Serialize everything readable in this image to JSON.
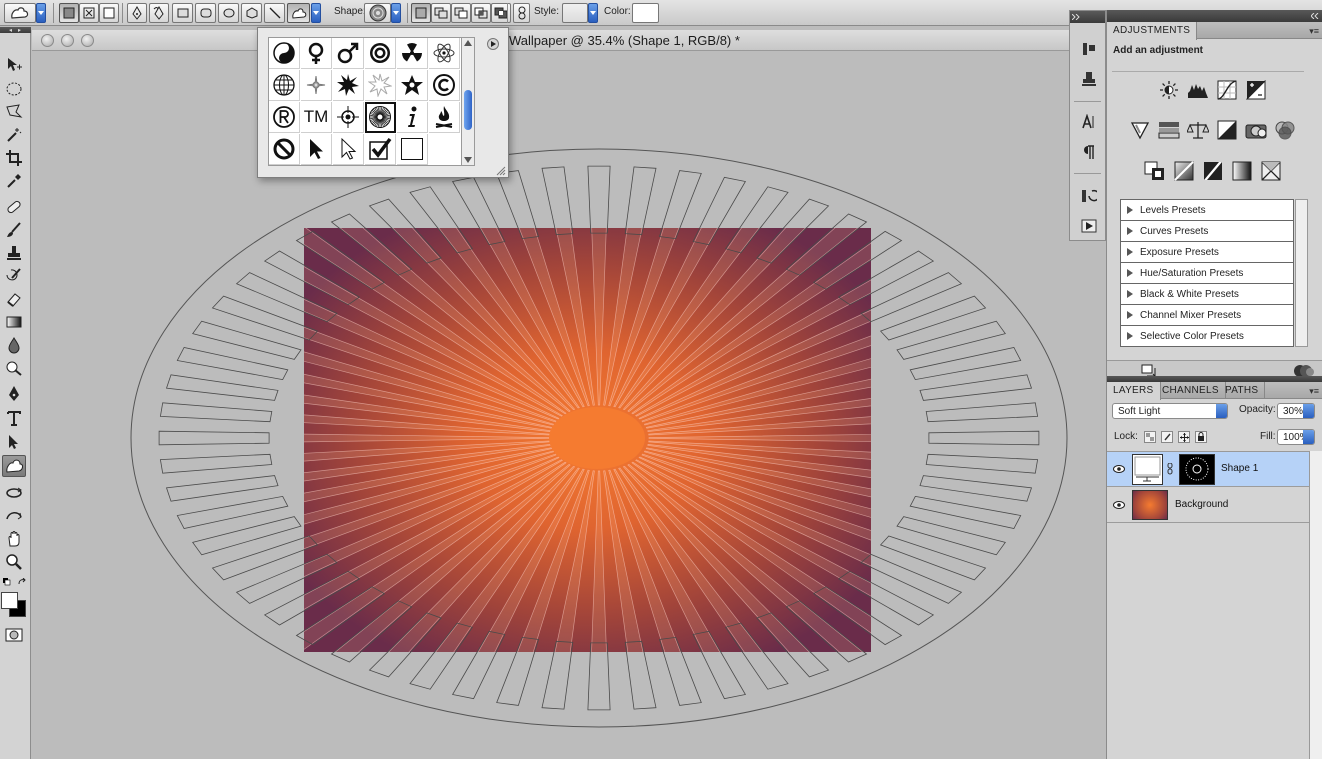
{
  "options_bar": {
    "shape_label": "Shape:",
    "style_label": "Style:",
    "color_label": "Color:",
    "color_value": "#ffffff"
  },
  "document": {
    "title": "Wallpaper @ 35.4% (Shape 1, RGB/8) *"
  },
  "shape_picker": {
    "shapes": [
      "yin-yang-icon",
      "female-symbol-icon",
      "male-symbol-icon",
      "target-icon",
      "radiation-icon",
      "atom-icon",
      "globe-icon",
      "compass-icon",
      "burst-icon",
      "burst-outline-icon",
      "star-icon",
      "copyright-icon",
      "registered-icon",
      "trademark-icon",
      "crosshair-icon",
      "circle-sunburst-icon",
      "info-icon",
      "fire-icon",
      "no-sign-icon",
      "cursor-arrow-icon",
      "cursor-arrow-outline-icon",
      "checkmark-icon",
      "blank-square-icon"
    ],
    "trademark_text": "TM",
    "selected": "circle-sunburst-icon"
  },
  "adjustments_panel": {
    "tab": "ADJUSTMENTS",
    "subtitle": "Add an adjustment",
    "presets": [
      "Levels Presets",
      "Curves Presets",
      "Exposure Presets",
      "Hue/Saturation Presets",
      "Black & White Presets",
      "Channel Mixer Presets",
      "Selective Color Presets"
    ]
  },
  "layers_panel": {
    "tabs": [
      "LAYERS",
      "CHANNELS",
      "PATHS"
    ],
    "active_tab": "LAYERS",
    "blend_mode": "Soft Light",
    "opacity_label": "Opacity:",
    "opacity_value": "30%",
    "lock_label": "Lock:",
    "fill_label": "Fill:",
    "fill_value": "100%",
    "layers": [
      {
        "name": "Shape 1",
        "selected": true
      },
      {
        "name": "Background",
        "selected": false
      }
    ]
  },
  "colors": {
    "accent": "#2a5fbf",
    "selection": "#b6d2f7",
    "canvas_center": "#f57b30",
    "canvas_edge": "#6a2c4a"
  }
}
